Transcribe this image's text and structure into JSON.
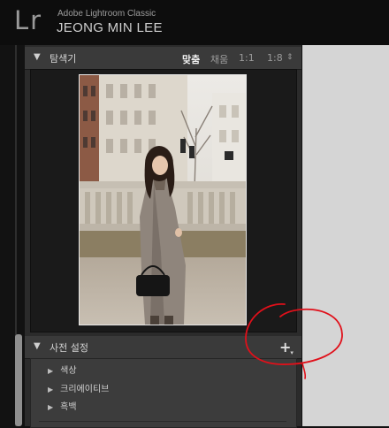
{
  "app": {
    "logo": "Lr",
    "product_name": "Adobe Lightroom Classic",
    "identity_plate": "JEONG MIN LEE"
  },
  "navigator": {
    "title": "탐색기",
    "zoom_options": [
      {
        "label": "맞춤",
        "active": true
      },
      {
        "label": "채움",
        "active": false
      },
      {
        "label": "1:1",
        "active": false
      },
      {
        "label": "1:8",
        "active": false
      }
    ],
    "stepper": "⇕"
  },
  "presets": {
    "title": "사전 설정",
    "add_button": "+",
    "add_menu_caret": "▾",
    "groups": [
      {
        "label": "색상"
      },
      {
        "label": "크리에이티브"
      },
      {
        "label": "흑백"
      }
    ]
  },
  "colors": {
    "annotation_red": "#e0101a",
    "panel_bg": "#2b2b2b",
    "header_bg": "#3a3a3a",
    "workspace_bg": "#d5d5d5"
  }
}
